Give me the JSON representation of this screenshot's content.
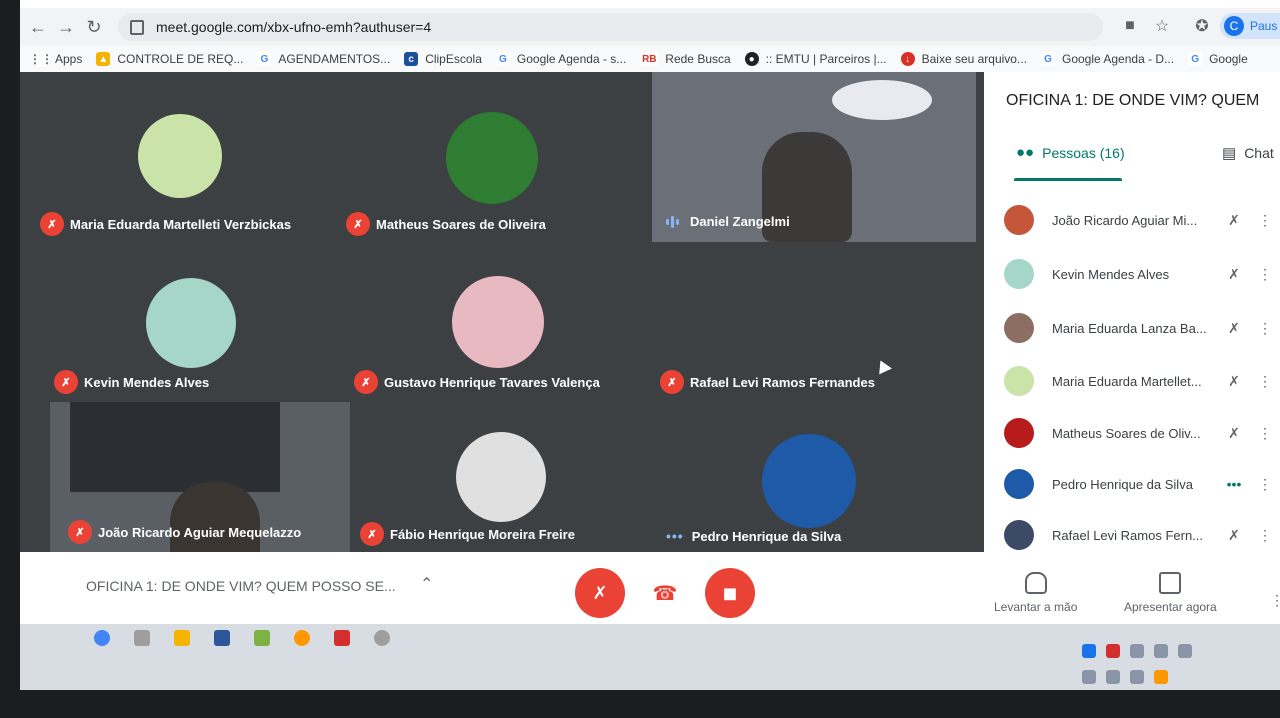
{
  "browser": {
    "url": "meet.google.com/xbx-ufno-emh?authuser=4",
    "profile_initial": "C",
    "profile_name": "Paus",
    "bookmarks": [
      {
        "label": "Apps",
        "icon": "apps-grid-icon",
        "color": "#5f6368"
      },
      {
        "label": "CONTROLE DE REQ...",
        "icon": "drive-icon",
        "color": "#f4b400"
      },
      {
        "label": "AGENDAMENTOS...",
        "icon": "google-icon",
        "color": "#4285f4"
      },
      {
        "label": "ClipEscola",
        "icon": "clipescola-icon",
        "color": "#1a4f9c"
      },
      {
        "label": "Google Agenda - s...",
        "icon": "google-icon",
        "color": "#4285f4"
      },
      {
        "label": "Rede Busca",
        "icon": "rb-icon",
        "color": "#d93025"
      },
      {
        "label": ":: EMTU | Parceiros |...",
        "icon": "emtu-icon",
        "color": "#202124"
      },
      {
        "label": "Baixe seu arquivo...",
        "icon": "download-icon",
        "color": "#d93025"
      },
      {
        "label": "Google Agenda - D...",
        "icon": "google-icon",
        "color": "#4285f4"
      },
      {
        "label": "Google",
        "icon": "google-icon",
        "color": "#4285f4"
      }
    ]
  },
  "participants": [
    {
      "name": "Maria Eduarda Martelleti Verzbickas",
      "status": "muted",
      "avatar_color": "#c9e3a8"
    },
    {
      "name": "Matheus Soares de Oliveira",
      "status": "muted",
      "avatar_color": "#2e7d32"
    },
    {
      "name": "Daniel Zangelmi",
      "status": "speaking",
      "avatar_color": "#6b6f78"
    },
    {
      "name": "Kevin Mendes Alves",
      "status": "muted",
      "avatar_color": "#a5d6c8"
    },
    {
      "name": "Gustavo Henrique Tavares Valença",
      "status": "muted",
      "avatar_color": "#e8b9c0"
    },
    {
      "name": "Rafael Levi Ramos Fernandes",
      "status": "muted",
      "avatar_color": "#3c4043"
    },
    {
      "name": "João Ricardo Aguiar Mequelazzo",
      "status": "muted",
      "avatar_color": "#5a5f66"
    },
    {
      "name": "Fábio Henrique Moreira Freire",
      "status": "muted",
      "avatar_color": "#e0e0e0"
    },
    {
      "name": "Pedro Henrique da Silva",
      "status": "connecting",
      "avatar_color": "#1e5aa8"
    }
  ],
  "side_panel": {
    "meeting_title": "OFICINA 1: DE ONDE VIM? QUEM",
    "people_tab": "Pessoas (16)",
    "chat_tab": "Chat",
    "people": [
      {
        "name": "João Ricardo Aguiar Mi...",
        "avatar_color": "#c4563a",
        "status": "muted"
      },
      {
        "name": "Kevin Mendes Alves",
        "avatar_color": "#a5d6c8",
        "status": "muted"
      },
      {
        "name": "Maria Eduarda Lanza Ba...",
        "avatar_color": "#8d6e63",
        "status": "muted"
      },
      {
        "name": "Maria Eduarda Martellet...",
        "avatar_color": "#c9e3a8",
        "status": "muted"
      },
      {
        "name": "Matheus Soares de Oliv...",
        "avatar_color": "#b71c1c",
        "status": "muted"
      },
      {
        "name": "Pedro Henrique da Silva",
        "avatar_color": "#1e5aa8",
        "status": "connecting"
      },
      {
        "name": "Rafael Levi Ramos Fern...",
        "avatar_color": "#3c4a66",
        "status": "muted"
      }
    ],
    "raise_hand": "Levantar a mão",
    "present_now": "Apresentar agora"
  },
  "bottom_bar": {
    "meeting_title": "OFICINA 1: DE ONDE VIM? QUEM POSSO SE..."
  },
  "colors": {
    "tile_bg": "#3c4043",
    "mute_red": "#ea4335",
    "accent_teal": "#00796b"
  }
}
